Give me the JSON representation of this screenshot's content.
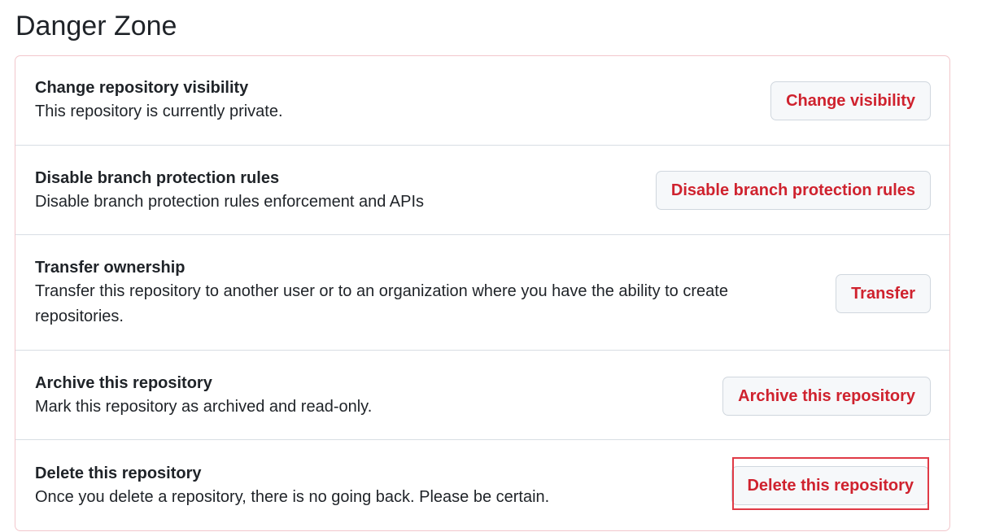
{
  "header": {
    "title": "Danger Zone"
  },
  "rows": [
    {
      "title": "Change repository visibility",
      "description": "This repository is currently private.",
      "button": "Change visibility"
    },
    {
      "title": "Disable branch protection rules",
      "description": "Disable branch protection rules enforcement and APIs",
      "button": "Disable branch protection rules"
    },
    {
      "title": "Transfer ownership",
      "description": "Transfer this repository to another user or to an organization where you have the ability to create repositories.",
      "button": "Transfer"
    },
    {
      "title": "Archive this repository",
      "description": "Mark this repository as archived and read-only.",
      "button": "Archive this repository"
    },
    {
      "title": "Delete this repository",
      "description": "Once you delete a repository, there is no going back. Please be certain.",
      "button": "Delete this repository"
    }
  ],
  "colors": {
    "danger_text": "#cf222e",
    "danger_border": "#f2c7cc",
    "focus_ring": "#e03a46"
  }
}
